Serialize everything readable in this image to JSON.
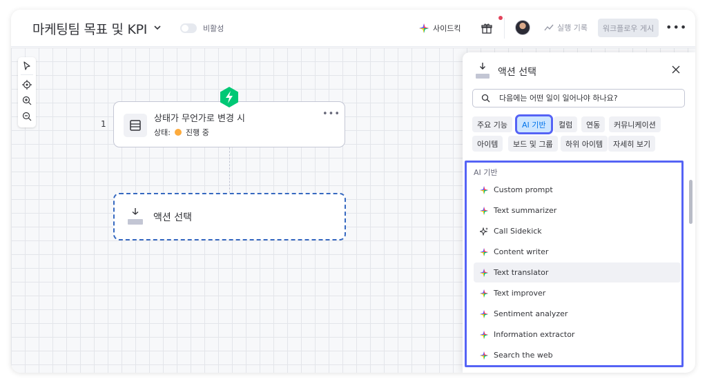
{
  "header": {
    "title": "마케팅팀 목표 및 KPI",
    "toggle_label": "비활성",
    "sidekick_label": "사이드킥",
    "run_log_label": "실행 기록",
    "publish_label": "워크플로우 게시"
  },
  "canvas": {
    "step_number": "1",
    "trigger": {
      "title": "상태가 무언가로 변경 시",
      "status_label": "상태:",
      "status_value": "진행 중"
    },
    "action_placeholder": "액션 선택"
  },
  "panel": {
    "title": "액션 선택",
    "search_placeholder": "다음에는 어떤 일이 일어나야 하나요?",
    "chips": [
      "주요 기능",
      "AI 기반",
      "컬럼",
      "연동",
      "커뮤니케이션",
      "아이템",
      "보드 및 그룹",
      "하위 아이템",
      "자세히 보기"
    ],
    "active_chip": "AI 기반",
    "section_header": "AI 기반",
    "items": [
      "Custom prompt",
      "Text summarizer",
      "Call Sidekick",
      "Content writer",
      "Text translator",
      "Text improver",
      "Sentiment analyzer",
      "Information extractor",
      "Search the web"
    ],
    "hovered_item": "Text translator"
  },
  "colors": {
    "accent": "#0073ea",
    "highlight_outline": "#5563f5",
    "trigger_green": "#00c875",
    "status_orange": "#fdab3d",
    "dashed_blue": "#3568c0"
  }
}
